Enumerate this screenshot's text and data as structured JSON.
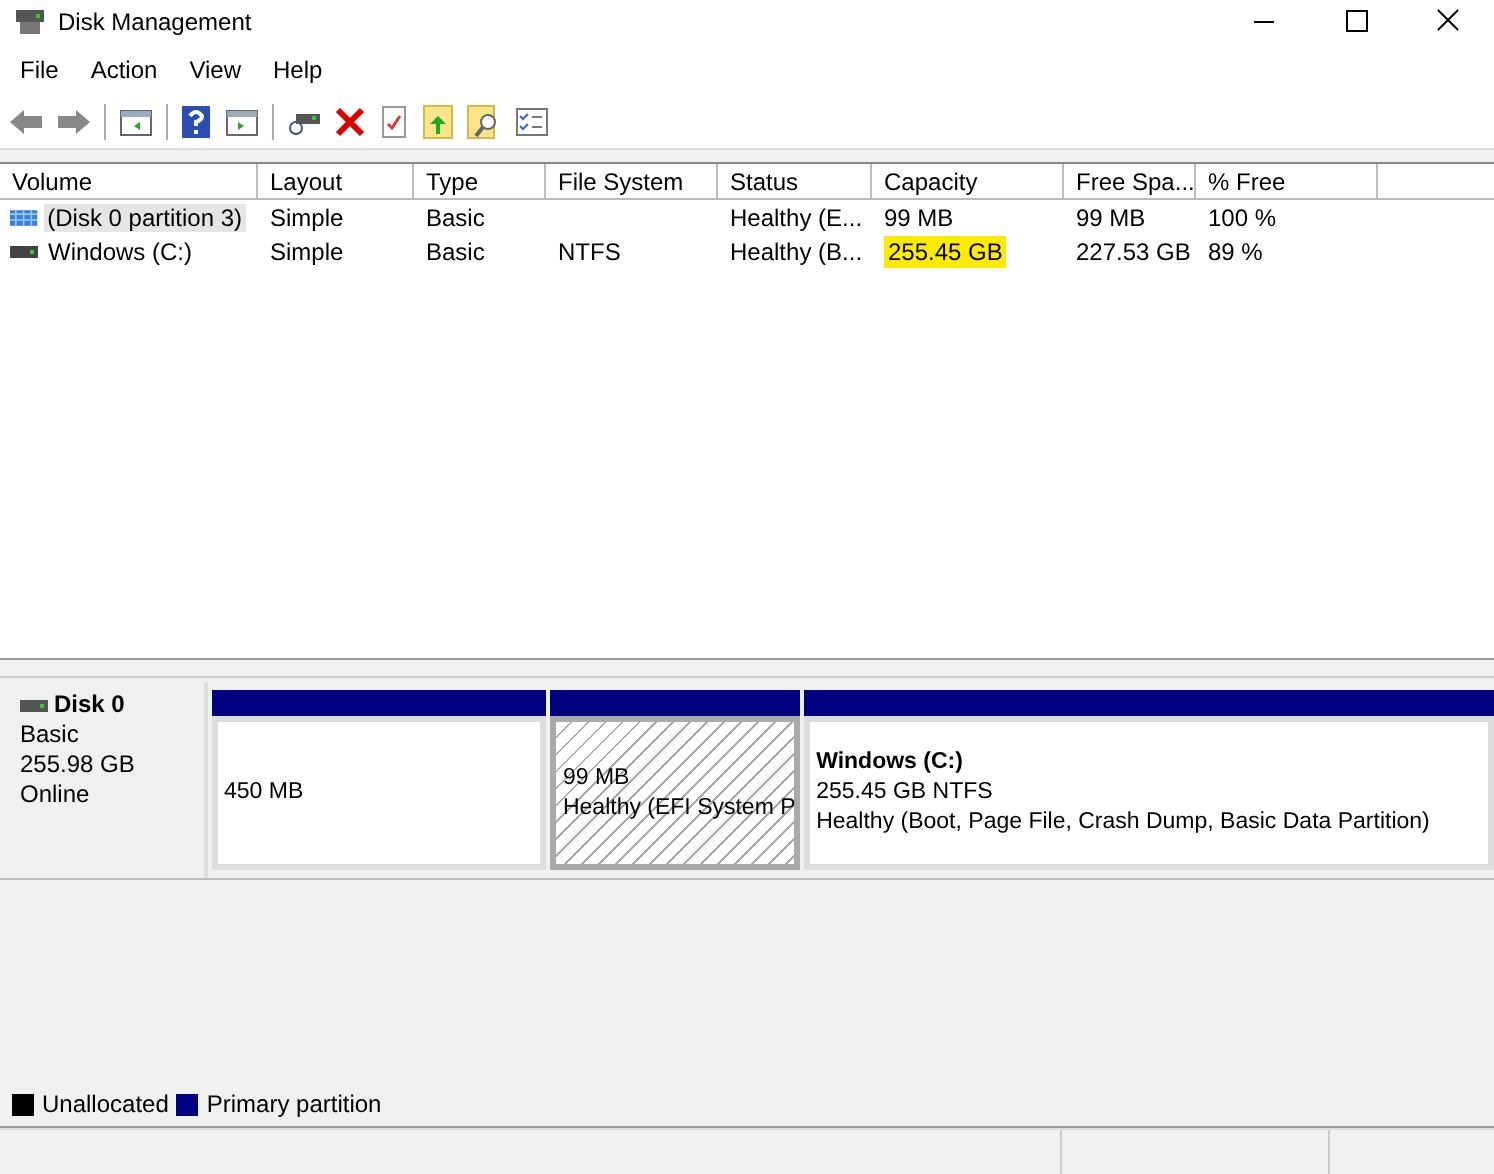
{
  "window": {
    "title": "Disk Management"
  },
  "menu": [
    "File",
    "Action",
    "View",
    "Help"
  ],
  "table": {
    "columns": [
      "Volume",
      "Layout",
      "Type",
      "File System",
      "Status",
      "Capacity",
      "Free Spa...",
      "% Free"
    ],
    "rows": [
      {
        "kind": "efi",
        "selected": true,
        "capacity_highlighted": false,
        "cells": [
          "(Disk 0 partition 3)",
          "Simple",
          "Basic",
          "",
          "Healthy (E...",
          "99 MB",
          "99 MB",
          "100 %"
        ]
      },
      {
        "kind": "drive",
        "selected": false,
        "capacity_highlighted": true,
        "cells": [
          "Windows (C:)",
          "Simple",
          "Basic",
          "NTFS",
          "Healthy (B...",
          "255.45 GB",
          "227.53 GB",
          "89 %"
        ]
      }
    ]
  },
  "disk": {
    "name": "Disk 0",
    "type": "Basic",
    "size": "255.98 GB",
    "status": "Online",
    "partitions": [
      {
        "selected": false,
        "lines": [
          "450 MB"
        ]
      },
      {
        "selected": true,
        "lines": [
          "99 MB",
          "Healthy (EFI System P"
        ]
      },
      {
        "selected": false,
        "title": "Windows  (C:)",
        "lines": [
          "255.45 GB NTFS",
          "Healthy (Boot, Page File, Crash Dump, Basic Data Partition)"
        ]
      }
    ]
  },
  "legend": [
    {
      "label": "Unallocated",
      "color": "#000000"
    },
    {
      "label": "Primary partition",
      "color": "#000080"
    }
  ]
}
